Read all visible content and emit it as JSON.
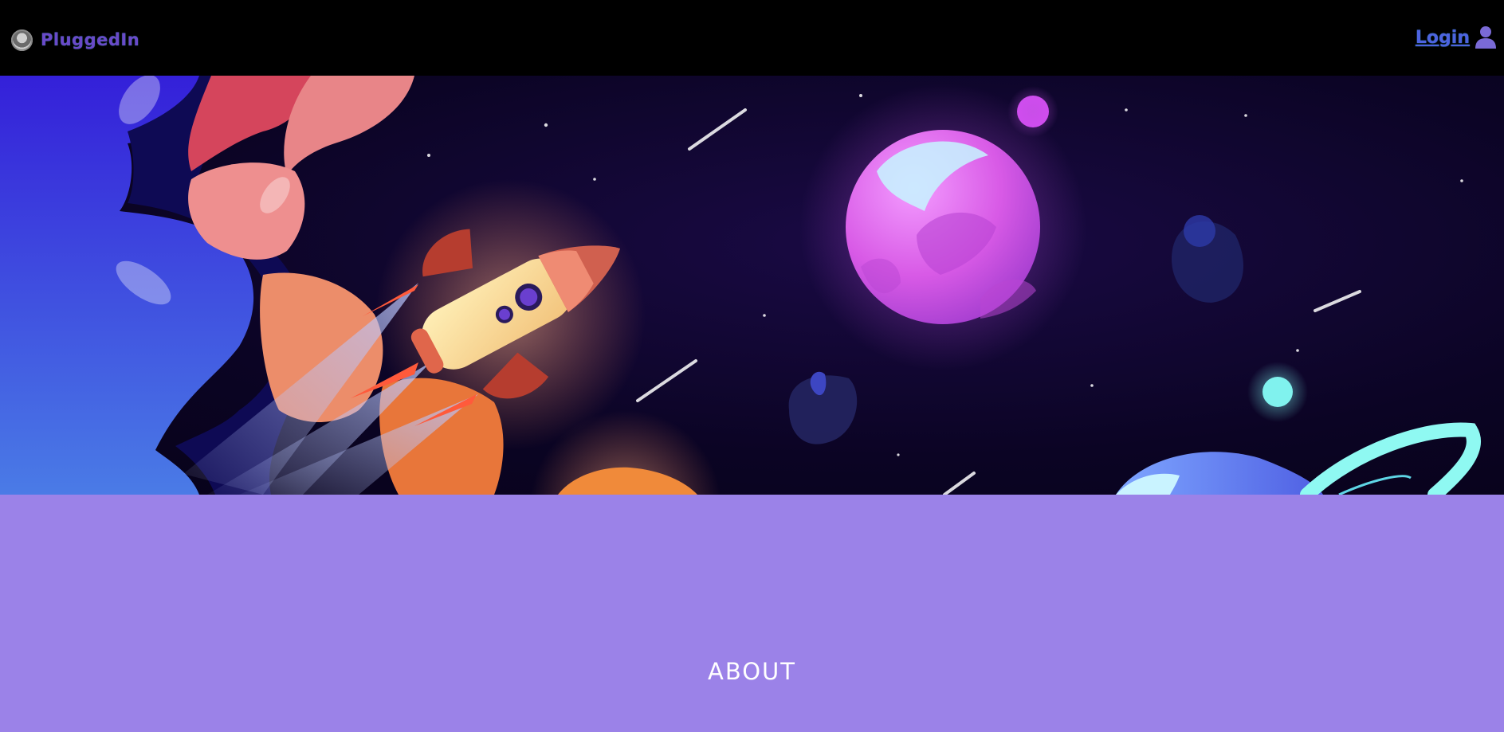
{
  "navbar": {
    "brand_name": "PluggedIn",
    "brand_logo_icon": "avatar-logo-icon",
    "login_label": "Login",
    "login_icon": "user-icon",
    "background": "#000000",
    "accent": "#4d63e0"
  },
  "hero": {
    "illustration": "space-rocket-illustration"
  },
  "section": {
    "title": "ABOUT",
    "background": "#9b82e8"
  }
}
